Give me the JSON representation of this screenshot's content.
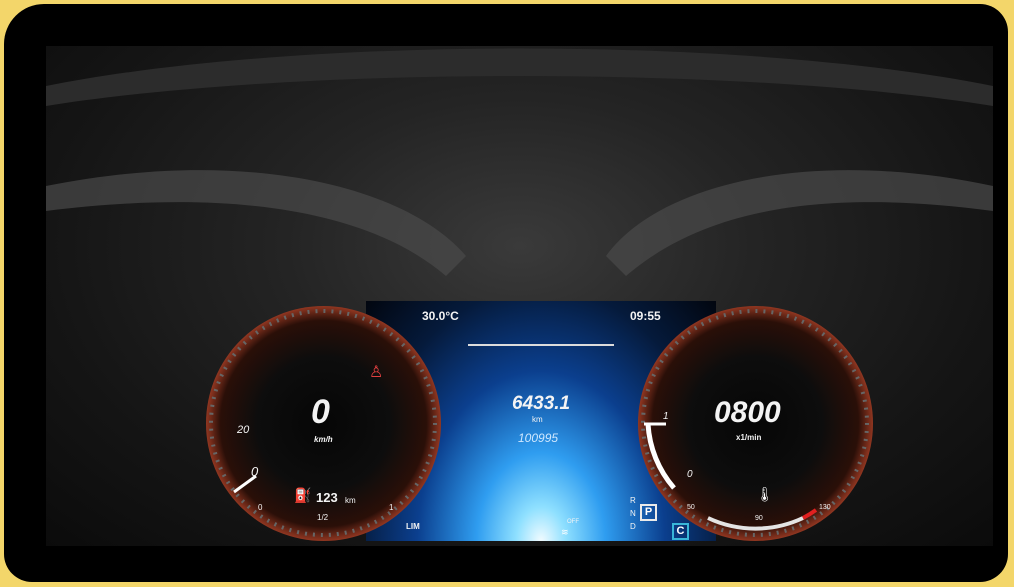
{
  "display": {
    "temperature": "30.0°C",
    "clock": "09:55",
    "trip_km": "6433.1",
    "trip_unit": "km",
    "odometer": "100995",
    "speed": "0",
    "speed_unit": "km/h",
    "speed_tick_20": "20",
    "speed_tick_0": "0",
    "range_value": "123",
    "range_unit": "km",
    "fuel_empty": "0",
    "fuel_half": "1/2",
    "fuel_full": "1",
    "rpm": "0800",
    "rpm_unit": "x1/min",
    "rpm_tick_1": "1",
    "rpm_tick_0": "0",
    "temp_50": "50",
    "temp_90": "90",
    "temp_130": "130",
    "limiter": "LIM",
    "gear_r": "R",
    "gear_n": "N",
    "gear_d": "D",
    "gear_selected": "P",
    "drive_mode": "C",
    "esp_status": "OFF"
  },
  "colors": {
    "frame_accent": "#f3d66a",
    "gauge_ring": "#b7452a",
    "center_glow": "#2f9df0",
    "mode_box": "#38b6d8"
  },
  "icons": [
    "seatbelt-warning-icon",
    "fuel-pump-icon",
    "coolant-temperature-icon",
    "esp-off-icon"
  ]
}
